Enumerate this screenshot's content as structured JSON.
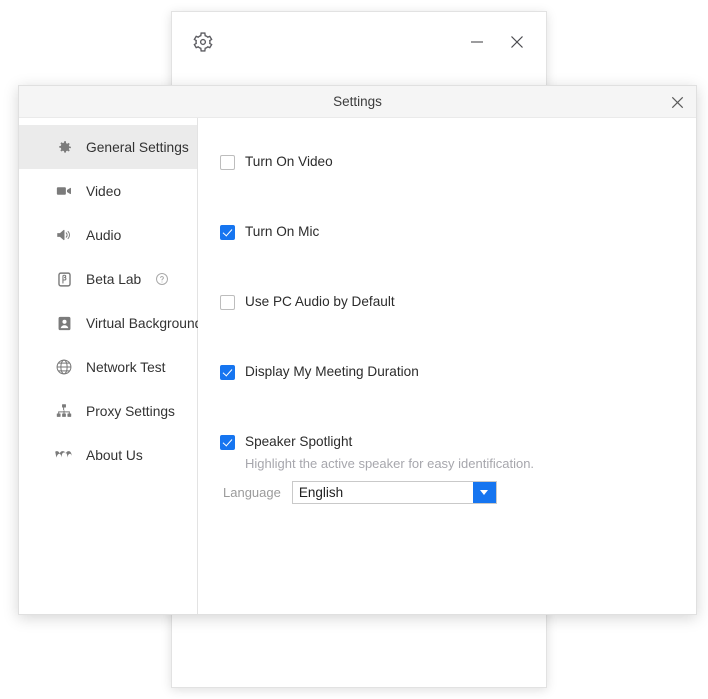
{
  "background_window": {
    "gear_icon": "gear-icon",
    "minimize_label": "─",
    "close_label": "✕"
  },
  "dialog": {
    "title": "Settings",
    "close_label": "✕"
  },
  "sidebar": {
    "items": [
      {
        "label": "General Settings",
        "icon": "gear-icon",
        "active": true
      },
      {
        "label": "Video",
        "icon": "video-camera-icon",
        "active": false
      },
      {
        "label": "Audio",
        "icon": "speaker-icon",
        "active": false
      },
      {
        "label": "Beta Lab",
        "icon": "beta-flask-icon",
        "active": false,
        "help": "help-circle-icon"
      },
      {
        "label": "Virtual Background",
        "icon": "person-card-icon",
        "active": false
      },
      {
        "label": "Network Test",
        "icon": "globe-icon",
        "active": false
      },
      {
        "label": "Proxy Settings",
        "icon": "sitemap-icon",
        "active": false
      },
      {
        "label": "About Us",
        "icon": "waves-icon",
        "active": false
      }
    ]
  },
  "general_settings": {
    "options": [
      {
        "label": "Turn On Video",
        "checked": false
      },
      {
        "label": "Turn On Mic",
        "checked": true
      },
      {
        "label": "Use PC Audio by Default",
        "checked": false
      },
      {
        "label": "Display My Meeting Duration",
        "checked": true
      },
      {
        "label": "Speaker Spotlight",
        "checked": true,
        "description": "Highlight the active speaker for easy identification."
      }
    ],
    "language": {
      "label": "Language",
      "value": "English",
      "options": [
        "English"
      ]
    }
  },
  "colors": {
    "accent": "#1675f0",
    "active_nav_bg": "#ebebeb",
    "titlebar_bg": "#f5f5f5",
    "text": "#2b2b2b",
    "muted_text": "#a7a7ad"
  }
}
